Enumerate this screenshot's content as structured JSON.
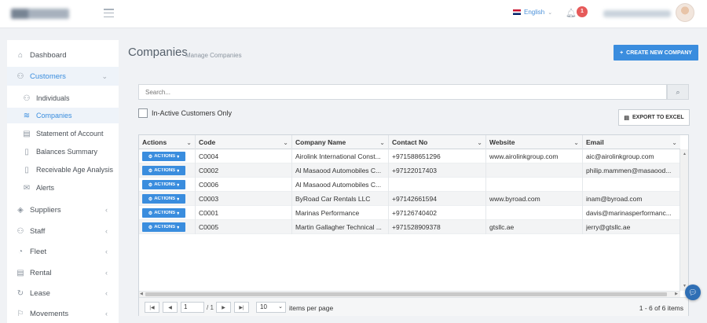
{
  "topbar": {
    "language": "English",
    "notification_count": "1",
    "icons": {
      "menu": "hamburger-icon",
      "bell": "bell-icon",
      "flag": "uk-flag-icon"
    }
  },
  "sidebar": {
    "items": [
      {
        "label": "Dashboard",
        "icon": "home-icon"
      },
      {
        "label": "Customers",
        "icon": "users-icon",
        "expanded": true
      },
      {
        "label": "Individuals",
        "icon": "user-icon"
      },
      {
        "label": "Companies",
        "icon": "layers-icon",
        "selected": true
      },
      {
        "label": "Statement of Account",
        "icon": "statement-icon"
      },
      {
        "label": "Balances Summary",
        "icon": "balance-icon"
      },
      {
        "label": "Receivable Age Analysis",
        "icon": "analysis-icon"
      },
      {
        "label": "Alerts",
        "icon": "mail-icon"
      },
      {
        "label": "Suppliers",
        "icon": "suppliers-icon"
      },
      {
        "label": "Staff",
        "icon": "staff-icon"
      },
      {
        "label": "Fleet",
        "icon": "fleet-icon"
      },
      {
        "label": "Rental",
        "icon": "rental-icon"
      },
      {
        "label": "Lease",
        "icon": "lease-icon"
      },
      {
        "label": "Movements",
        "icon": "movements-icon"
      }
    ]
  },
  "main": {
    "title": "Companies",
    "subtitle": "Manage Companies",
    "create_label": "CREATE NEW COMPANY",
    "search_placeholder": "Search...",
    "inactive_label": "In-Active Customers Only",
    "export_label": "EXPORT TO EXCEL"
  },
  "grid": {
    "columns": [
      "Actions",
      "Code",
      "Company Name",
      "Contact No",
      "Website",
      "Email"
    ],
    "action_label": "ACTIONS",
    "rows": [
      {
        "code": "C0004",
        "name": "Airolink International Const...",
        "contact": "+971588651296",
        "website": "www.airolinkgroup.com",
        "email": "aic@airolinkgroup.com"
      },
      {
        "code": "C0002",
        "name": "Al Masaood Automobiles C...",
        "contact": "+97122017403",
        "website": "",
        "email": "philip.mammen@masaood..."
      },
      {
        "code": "C0006",
        "name": "Al Masaood Automobiles C...",
        "contact": "",
        "website": "",
        "email": ""
      },
      {
        "code": "C0003",
        "name": "ByRoad Car Rentals LLC",
        "contact": "+97142661594",
        "website": "www.byroad.com",
        "email": "inam@byroad.com"
      },
      {
        "code": "C0001",
        "name": "Marinas Performance",
        "contact": "+97126740402",
        "website": "",
        "email": "davis@marinasperformanc..."
      },
      {
        "code": "C0005",
        "name": "Martin Gallagher Technical ...",
        "contact": "+971528909378",
        "website": "gtsllc.ae",
        "email": "jerry@gtsllc.ae"
      }
    ]
  },
  "pager": {
    "page": "1",
    "of": "1",
    "page_size": "10",
    "items_label": "items per page",
    "info": "1 - 6 of 6 items"
  },
  "colors": {
    "accent": "#3a8dde"
  }
}
